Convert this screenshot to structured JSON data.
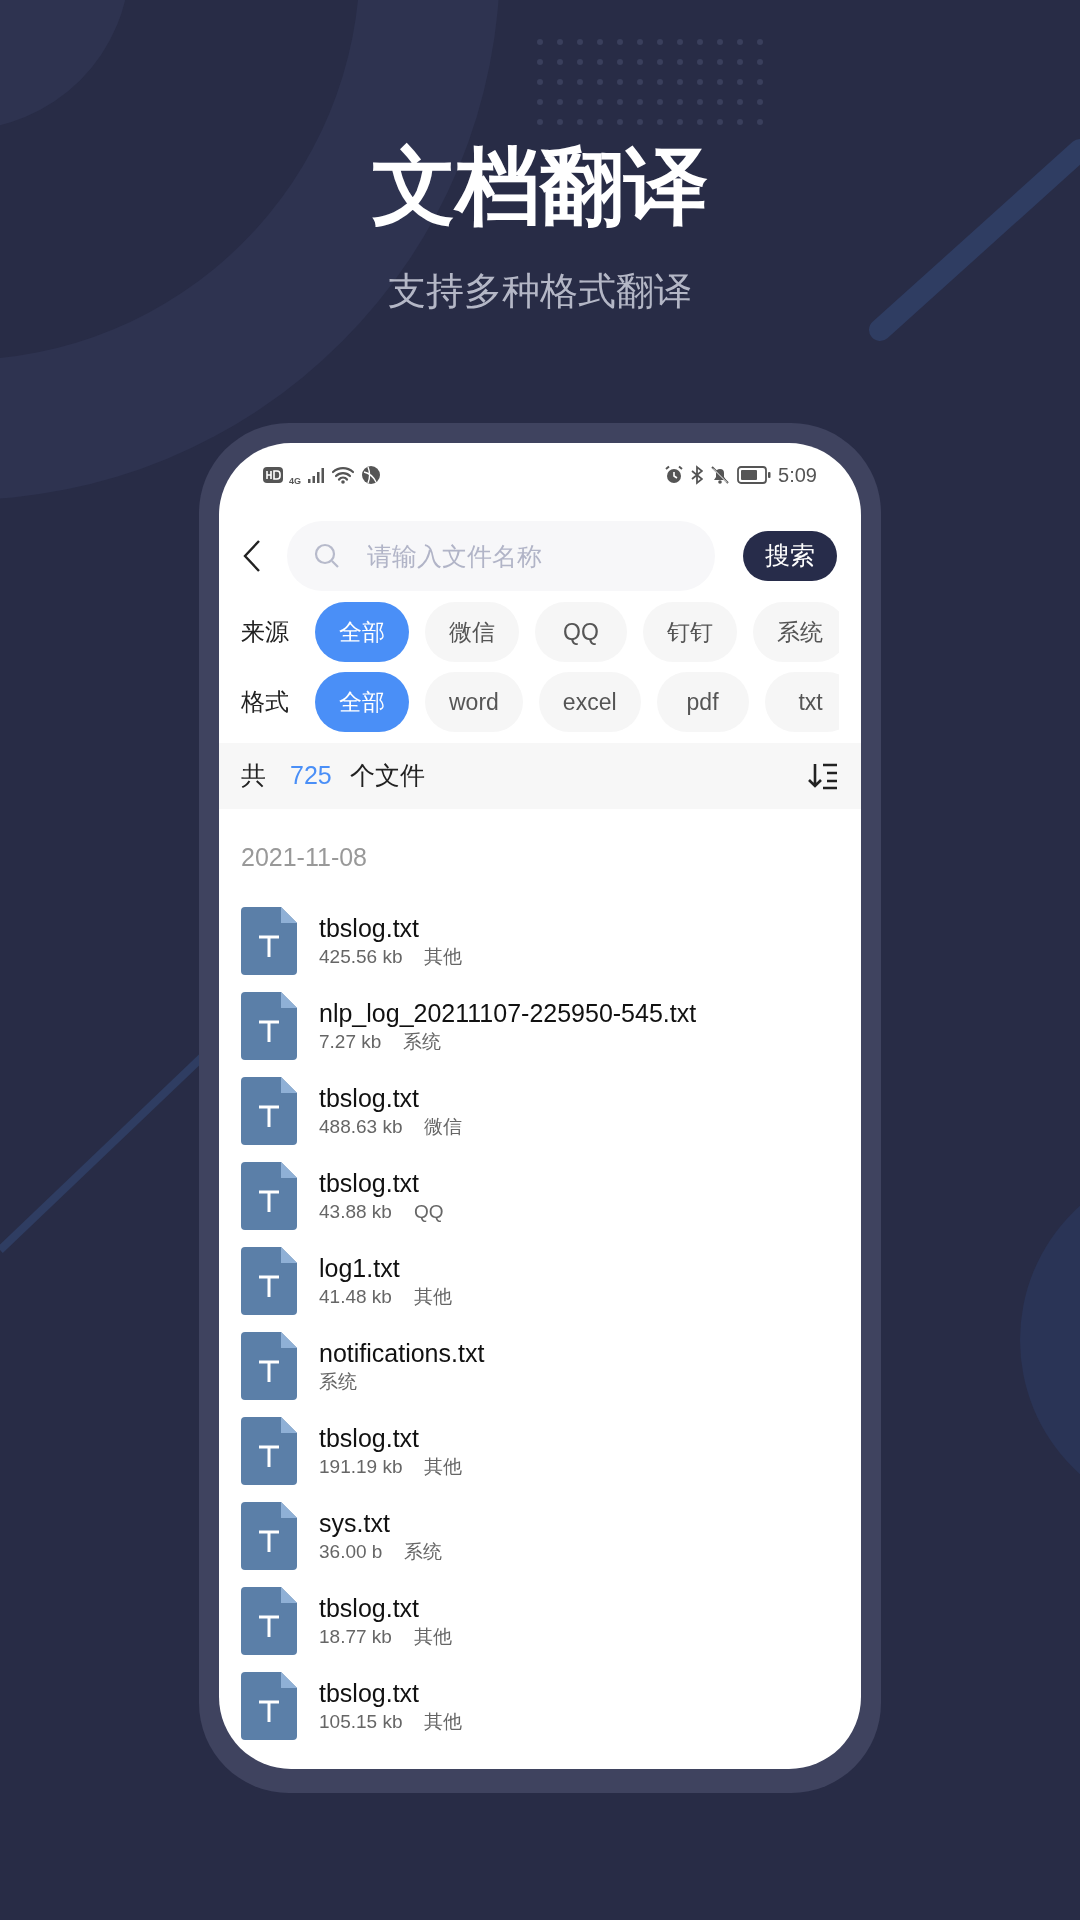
{
  "headline": "文档翻译",
  "subtitle": "支持多种格式翻译",
  "status_bar": {
    "time": "5:09",
    "network": "4G"
  },
  "search": {
    "placeholder": "请输入文件名称",
    "button": "搜索"
  },
  "filters": [
    {
      "label": "来源",
      "options": [
        {
          "label": "全部",
          "selected": true
        },
        {
          "label": "微信",
          "selected": false
        },
        {
          "label": "QQ",
          "selected": false
        },
        {
          "label": "钉钉",
          "selected": false
        },
        {
          "label": "系统",
          "selected": false
        }
      ]
    },
    {
      "label": "格式",
      "options": [
        {
          "label": "全部",
          "selected": true
        },
        {
          "label": "word",
          "selected": false
        },
        {
          "label": "excel",
          "selected": false
        },
        {
          "label": "pdf",
          "selected": false
        },
        {
          "label": "txt",
          "selected": false
        }
      ]
    }
  ],
  "summary": {
    "prefix": "共",
    "count": "725",
    "suffix": "个文件"
  },
  "date": "2021-11-08",
  "files": [
    {
      "name": "tbslog.txt",
      "size": "425.56 kb",
      "source": "其他"
    },
    {
      "name": "nlp_log_20211107-225950-545.txt",
      "size": "7.27 kb",
      "source": "系统"
    },
    {
      "name": "tbslog.txt",
      "size": "488.63 kb",
      "source": "微信"
    },
    {
      "name": "tbslog.txt",
      "size": "43.88 kb",
      "source": "QQ"
    },
    {
      "name": "log1.txt",
      "size": "41.48 kb",
      "source": "其他"
    },
    {
      "name": "notifications.txt",
      "source": "系统"
    },
    {
      "name": "tbslog.txt",
      "size": "191.19 kb",
      "source": "其他"
    },
    {
      "name": "sys.txt",
      "size": "36.00 b",
      "source": "系统"
    },
    {
      "name": "tbslog.txt",
      "size": "18.77 kb",
      "source": "其他"
    },
    {
      "name": "tbslog.txt",
      "size": "105.15 kb",
      "source": "其他"
    }
  ]
}
